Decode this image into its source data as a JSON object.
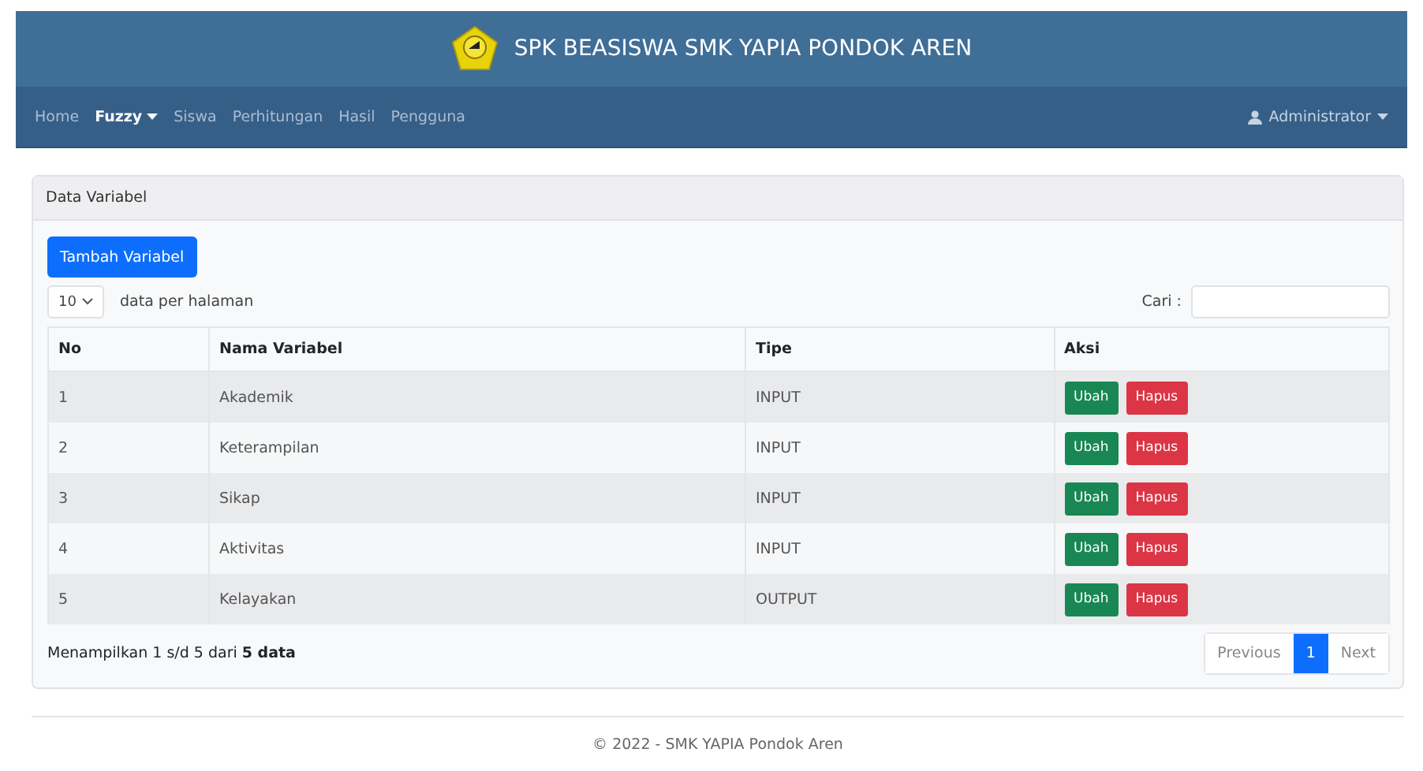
{
  "header": {
    "title": "SPK BEASISWA SMK YAPIA PONDOK AREN"
  },
  "nav": {
    "items": [
      {
        "label": "Home",
        "selected": false,
        "dropdown": false
      },
      {
        "label": "Fuzzy",
        "selected": true,
        "dropdown": true
      },
      {
        "label": "Siswa",
        "selected": false,
        "dropdown": false
      },
      {
        "label": "Perhitungan",
        "selected": false,
        "dropdown": false
      },
      {
        "label": "Hasil",
        "selected": false,
        "dropdown": false
      },
      {
        "label": "Pengguna",
        "selected": false,
        "dropdown": false
      }
    ],
    "user": "Administrator"
  },
  "card": {
    "title": "Data Variabel",
    "add_button": "Tambah Variabel",
    "page_size": "10",
    "page_size_label": "data per halaman",
    "search_label": "Cari :",
    "table": {
      "columns": [
        "No",
        "Nama Variabel",
        "Tipe",
        "Aksi"
      ],
      "rows": [
        {
          "no": "1",
          "name": "Akademik",
          "type": "INPUT",
          "actions": [
            "Ubah",
            "Hapus"
          ]
        },
        {
          "no": "2",
          "name": "Keterampilan",
          "type": "INPUT",
          "actions": [
            "Ubah",
            "Hapus"
          ]
        },
        {
          "no": "3",
          "name": "Sikap",
          "type": "INPUT",
          "actions": [
            "Ubah",
            "Hapus"
          ]
        },
        {
          "no": "4",
          "name": "Aktivitas",
          "type": "INPUT",
          "actions": [
            "Ubah",
            "Hapus"
          ]
        },
        {
          "no": "5",
          "name": "Kelayakan",
          "type": "OUTPUT",
          "actions": [
            "Ubah",
            "Hapus"
          ]
        }
      ]
    },
    "info": "Menampilkan 1 s/d 5 dari **5 data**",
    "pagination": [
      {
        "label": "Previous",
        "selected": false
      },
      {
        "label": "1",
        "selected": true
      },
      {
        "label": "Next",
        "selected": false
      }
    ]
  },
  "footer": "© 2022 - SMK YAPIA Pondok Aren"
}
